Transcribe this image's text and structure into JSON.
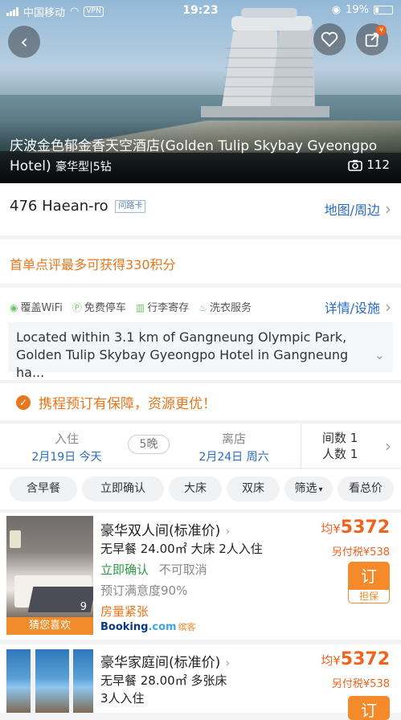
{
  "status": {
    "carrier": "中国移动",
    "vpn": "VPN",
    "time": "19:23",
    "battery": "19%"
  },
  "hero": {
    "back_icon": "chevron-left-icon",
    "favorite_icon": "heart-icon",
    "share_icon": "share-icon",
    "share_badge": "¥",
    "title": "庆波金色郁金香天空酒店(Golden Tulip Skybay Gyeongpo Hotel)",
    "subtitle": "豪华型|5钻",
    "photo_count": "112"
  },
  "address": {
    "text": "476 Haean-ro",
    "tag": "问路卡",
    "map_link": "地图/周边"
  },
  "promo": {
    "text": "首单点评最多可获得330积分"
  },
  "facilities": {
    "items": [
      {
        "icon": "wifi-icon",
        "label": "覆盖WiFi"
      },
      {
        "icon": "parking-icon",
        "label": "免费停车"
      },
      {
        "icon": "luggage-icon",
        "label": "行李寄存"
      },
      {
        "icon": "laundry-icon",
        "label": "洗衣服务"
      }
    ],
    "details_link": "详情/设施",
    "description_line1": "Located within 3.1 km of Gangneung Olympic Park,",
    "description_line2": "Golden Tulip Skybay Gyeongpo Hotel in Gangneung ha..."
  },
  "guarantee": {
    "text": "携程预订有保障，资源更优！"
  },
  "dates": {
    "checkin_label": "入住",
    "checkin_value": "2月19日 今天",
    "nights": "5晚",
    "checkout_label": "离店",
    "checkout_value": "2月24日 周六",
    "rooms_label": "间数 1",
    "guests_label": "人数 1"
  },
  "filters": [
    "含早餐",
    "立即确认",
    "大床",
    "双床",
    "筛选",
    "看总价"
  ],
  "rooms": [
    {
      "name": "豪华双人间(标准价)",
      "detail": "无早餐 24.00㎡ 大床 2人入住",
      "confirm": "立即确认",
      "cancel": "不可取消",
      "satisfaction": "预订满意度90%",
      "stock": "房量紧张",
      "photo_count": "9",
      "badge": "猜您喜欢",
      "price_prefix": "均¥",
      "price": "5372",
      "tax": "另付税¥538",
      "book": "订",
      "book_sub": "担保",
      "provider": "Booking",
      "provider_dot": ".com",
      "provider_cn": "缤客"
    },
    {
      "name": "豪华家庭间(标准价)",
      "detail": "无早餐 28.00㎡ 多张床",
      "detail2": "3人入住",
      "price_prefix": "均¥",
      "price": "5372",
      "tax": "另付税¥538",
      "book": "订"
    }
  ]
}
